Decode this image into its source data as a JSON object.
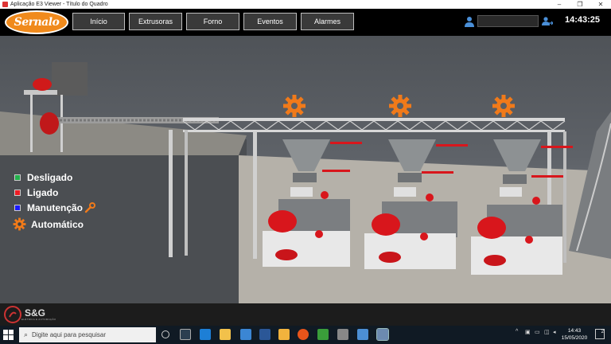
{
  "window": {
    "title": "Aplicação E3 Viewer - Título do Quadro",
    "controls": [
      "–",
      "❐",
      "✕"
    ]
  },
  "header": {
    "logo_text": "Sernalo",
    "nav": [
      {
        "label": "Início"
      },
      {
        "label": "Extrusoras"
      },
      {
        "label": "Forno"
      },
      {
        "label": "Eventos"
      },
      {
        "label": "Alarmes"
      }
    ],
    "user_field_value": "",
    "clock": "14:43:25"
  },
  "legend": [
    {
      "label": "Desligado",
      "color": "#22b14c"
    },
    {
      "label": "Ligado",
      "color": "#ed1c24"
    },
    {
      "label": "Manutenção",
      "color": "#1a1aff"
    },
    {
      "label": "Automático",
      "color": "#f07a1a"
    }
  ],
  "colors": {
    "accent_orange": "#f07a1a",
    "motor_red": "#d8161c",
    "header_bg": "#000000"
  },
  "footer": {
    "brand": "S&G",
    "brand_sub": "ELÉTRICA E AUTOMAÇÃO"
  },
  "taskbar": {
    "search_placeholder": "Digite aqui para pesquisar",
    "time": "14:43",
    "date": "15/05/2020",
    "notification_count": "2"
  }
}
